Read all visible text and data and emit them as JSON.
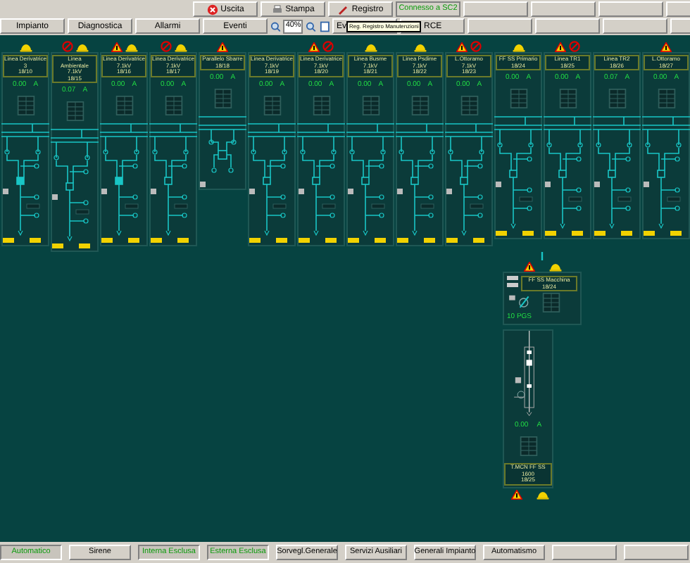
{
  "toolbar_top": [
    {
      "label": "Uscita",
      "kind": "exit"
    },
    {
      "label": "Stampa",
      "kind": "print"
    },
    {
      "label": "Registro",
      "kind": "log"
    },
    {
      "label": "Connesso a SC2",
      "kind": "status"
    }
  ],
  "toolbar_nav": [
    "Impianto",
    "Diagnostica",
    "Allarmi",
    "Eventi"
  ],
  "zoom": {
    "value": "40%"
  },
  "toolbar_more": [
    "Ev",
    "RCE"
  ],
  "tooltip": "Reg. Registro Manutenzioni",
  "panels": [
    {
      "name": "Linea Derivatrice 3",
      "code": "18/10",
      "reading": "0.00",
      "unit": "A",
      "kind": "feeder",
      "closed": true,
      "warning": false,
      "forbidden": false,
      "helmet": true
    },
    {
      "name": "Linea Ambientale 7.1kV",
      "code": "18/15",
      "reading": "0.07",
      "unit": "A",
      "kind": "feeder",
      "closed": false,
      "warning": false,
      "forbidden": true,
      "helmet": true
    },
    {
      "name": "Linea Derivatrice 7.1kV",
      "code": "18/16",
      "reading": "0.00",
      "unit": "A",
      "kind": "feeder",
      "closed": true,
      "warning": true,
      "forbidden": false,
      "helmet": true
    },
    {
      "name": "Linea Derivatrice 7.1kV",
      "code": "18/17",
      "reading": "0.00",
      "unit": "A",
      "kind": "feeder",
      "closed": false,
      "warning": false,
      "forbidden": true,
      "helmet": true
    },
    {
      "name": "Parallelo Sbarre",
      "code": "18/18",
      "reading": "0.00",
      "unit": "A",
      "kind": "coupler",
      "closed": false,
      "warning": true,
      "forbidden": false,
      "helmet": false
    },
    {
      "name": "Linea Derivatrice 7.1kV",
      "code": "18/19",
      "reading": "0.00",
      "unit": "A",
      "kind": "feeder",
      "closed": false,
      "warning": false,
      "forbidden": false,
      "helmet": false
    },
    {
      "name": "Linea Derivatrice 7.1kV",
      "code": "18/20",
      "reading": "0.00",
      "unit": "A",
      "kind": "feeder",
      "closed": false,
      "warning": true,
      "forbidden": true,
      "helmet": false
    },
    {
      "name": "Linea Busme 7.1kV",
      "code": "18/21",
      "reading": "0.00",
      "unit": "A",
      "kind": "feeder",
      "closed": false,
      "warning": false,
      "forbidden": false,
      "helmet": true
    },
    {
      "name": "Linea Psdime 7.1kV",
      "code": "18/22",
      "reading": "0.00",
      "unit": "A",
      "kind": "feeder",
      "closed": false,
      "warning": false,
      "forbidden": false,
      "helmet": true
    },
    {
      "name": "L.Ottoramo 7.1kV",
      "code": "18/23",
      "reading": "0.00",
      "unit": "A",
      "kind": "feeder",
      "closed": false,
      "warning": true,
      "forbidden": true,
      "helmet": false
    },
    {
      "name": "FF SS Primario",
      "code": "18/24",
      "reading": "0.00",
      "unit": "A",
      "kind": "feeder",
      "closed": false,
      "warning": false,
      "forbidden": false,
      "helmet": true
    },
    {
      "name": "Linea TR1",
      "code": "18/25",
      "reading": "0.00",
      "unit": "A",
      "kind": "feeder",
      "closed": false,
      "warning": true,
      "forbidden": true,
      "helmet": false
    },
    {
      "name": "Linea TR2",
      "code": "18/26",
      "reading": "0.07",
      "unit": "A",
      "kind": "feeder",
      "closed": false,
      "warning": false,
      "forbidden": false,
      "helmet": false
    },
    {
      "name": "L.Ottoramo",
      "code": "18/27",
      "reading": "0.00",
      "unit": "A",
      "kind": "feeder",
      "closed": false,
      "warning": true,
      "forbidden": false,
      "helmet": false
    }
  ],
  "machine_panel": {
    "top_warning": true,
    "top_helmet": true,
    "title": "FF SS Macchina",
    "code": "18/24",
    "label": "10 PGS",
    "reading": "0.00",
    "unit": "A",
    "bottom_title": "T.MCN FF SS 1600",
    "bottom_code": "18/25",
    "bottom_warning": true,
    "bottom_helmet": true
  },
  "bottom_bar": [
    {
      "label": "Automatico",
      "active": true
    },
    {
      "label": "Sirene",
      "active": false
    },
    {
      "label": "Interna Esclusa",
      "active": true
    },
    {
      "label": "Esterna Esclusa",
      "active": true
    },
    {
      "label": "Sorvegl.Generale",
      "active": false
    },
    {
      "label": "Servizi Ausiliari",
      "active": false
    },
    {
      "label": "Generali Impianto",
      "active": false
    },
    {
      "label": "Automatismo",
      "active": false
    }
  ]
}
